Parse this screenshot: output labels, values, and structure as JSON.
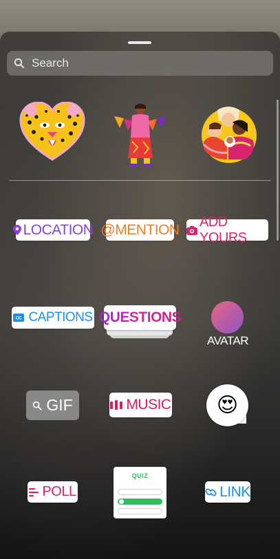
{
  "search": {
    "placeholder": "Search",
    "icon": "search-icon"
  },
  "featured_stickers": [
    {
      "name": "leopard-heart-sticker"
    },
    {
      "name": "bunting-person-sticker"
    },
    {
      "name": "hugging-family-sticker"
    }
  ],
  "stickers": {
    "location": {
      "label": "LOCATION",
      "icon": "location-pin-icon",
      "color": "#8a3ee0"
    },
    "mention": {
      "label": "@MENTION",
      "color": "#f07d22"
    },
    "add_yours": {
      "label": "ADD YOURS",
      "icon": "camera-icon",
      "color": "#d8246f"
    },
    "captions": {
      "label": "CAPTIONS",
      "icon": "cc-icon",
      "color": "#1d8fe8"
    },
    "questions": {
      "label": "QUESTIONS"
    },
    "avatar": {
      "label": "AVATAR"
    },
    "gif": {
      "label": "GIF",
      "icon": "search-icon"
    },
    "music": {
      "label": "MUSIC",
      "icon": "audio-bars-icon",
      "color": "#d4205c"
    },
    "emoji_slider": {
      "emoji": "😍"
    },
    "poll": {
      "label": "POLL",
      "icon": "poll-lines-icon",
      "color": "#d4206c"
    },
    "quiz": {
      "label": "QUIZ",
      "color": "#2cbf5b"
    },
    "link": {
      "label": "LINK",
      "icon": "link-icon",
      "color": "#1d8fe8"
    }
  }
}
